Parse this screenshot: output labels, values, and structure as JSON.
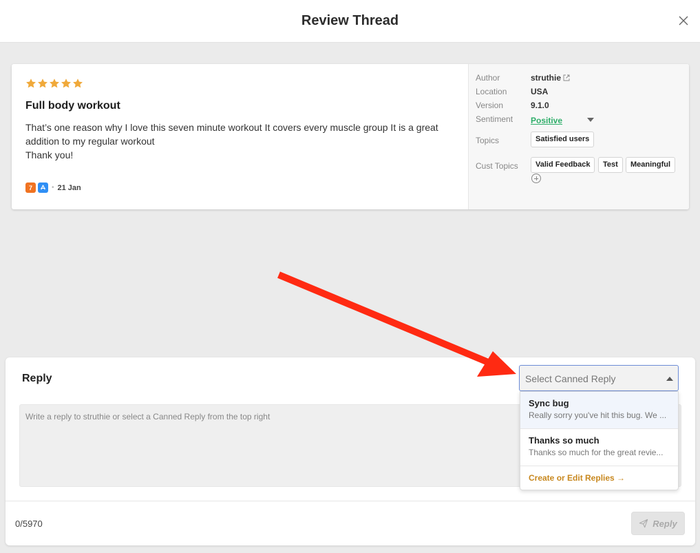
{
  "header": {
    "title": "Review Thread"
  },
  "review": {
    "rating": 5,
    "title": "Full body workout",
    "body": "That’s one reason why I love this seven minute workout It covers every muscle group It is a great addition to my regular workout\nThank you!",
    "app_badge_label": "7",
    "date": "21 Jan"
  },
  "meta": {
    "author_label": "Author",
    "author": "struthie",
    "location_label": "Location",
    "location": "USA",
    "version_label": "Version",
    "version": "9.1.0",
    "sentiment_label": "Sentiment",
    "sentiment": "Positive",
    "topics_label": "Topics",
    "topics": [
      "Satisfied users"
    ],
    "cust_topics_label": "Cust Topics",
    "cust_topics": [
      "Valid Feedback",
      "Test",
      "Meaningful"
    ]
  },
  "reply": {
    "heading": "Reply",
    "placeholder": "Write a reply to struthie or select a Canned Reply from the top right",
    "char_count": "0/5970",
    "button_label": "Reply"
  },
  "canned": {
    "placeholder": "Select Canned Reply",
    "options": [
      {
        "title": "Sync bug",
        "preview": "Really sorry you've hit this bug. We ..."
      },
      {
        "title": "Thanks so much",
        "preview": "Thanks so much for the great revie..."
      }
    ],
    "manage_link": "Create or Edit Replies →"
  },
  "colors": {
    "star": "#f0a93a",
    "sentiment_positive": "#2fae6a",
    "annotation_arrow": "#ff2a12",
    "link": "#c8881f",
    "select_border": "#6b8bd6"
  },
  "icons": [
    "close-icon",
    "star-icon",
    "external-link-icon",
    "chevron-down-icon",
    "add-circle-icon",
    "send-icon",
    "app-store-icon"
  ]
}
